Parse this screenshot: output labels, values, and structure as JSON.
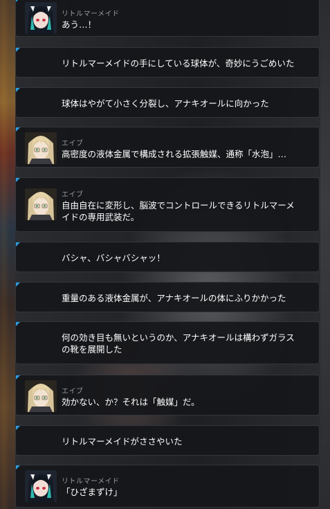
{
  "dialogue_log": [
    {
      "speaker": "リトルマーメイド",
      "avatar": "little-mermaid",
      "text": "あう…！"
    },
    {
      "speaker": "",
      "avatar": "",
      "text": "リトルマーメイドの手にしている球体が、奇妙にうごめいた"
    },
    {
      "speaker": "",
      "avatar": "",
      "text": "球体はやがて小さく分裂し、アナキオールに向かった"
    },
    {
      "speaker": "エイブ",
      "avatar": "abe",
      "text": "高密度の液体金属で構成される拡張触媒、通称「水泡」…"
    },
    {
      "speaker": "エイブ",
      "avatar": "abe",
      "text": "自由自在に変形し、脳波でコントロールできるリトルマーメ\nイドの専用武装だ。"
    },
    {
      "speaker": "",
      "avatar": "",
      "text": "バシャ、バシャバシャッ！"
    },
    {
      "speaker": "",
      "avatar": "",
      "text": "重量のある液体金属が、アナキオールの体にふりかかった"
    },
    {
      "speaker": "",
      "avatar": "",
      "text": "何の効き目も無いというのか、アナキオールは構わずガラス\nの靴を展開した"
    },
    {
      "speaker": "エイブ",
      "avatar": "abe",
      "text": "効かない、か？それは「触媒」だ。"
    },
    {
      "speaker": "",
      "avatar": "",
      "text": "リトルマーメイドがささやいた"
    },
    {
      "speaker": "リトルマーメイド",
      "avatar": "little-mermaid",
      "text": "「ひざまずけ」"
    }
  ],
  "colors": {
    "accent": "#2a9de0",
    "panel": "#16171a",
    "speaker": "#9a9ca2",
    "text": "#ffffff"
  }
}
